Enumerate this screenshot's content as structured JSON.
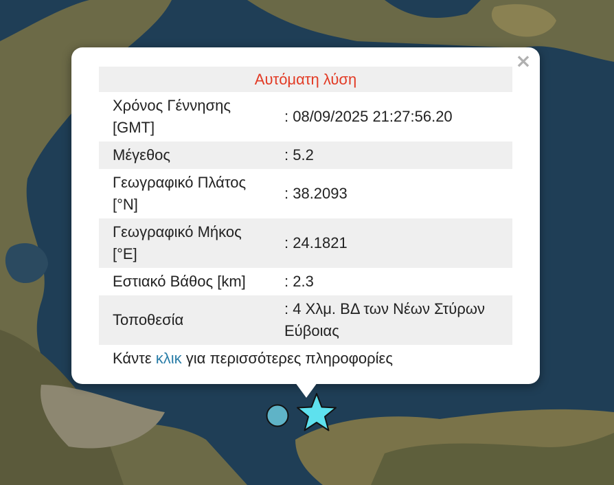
{
  "popup": {
    "close_label": "×",
    "title": "Αυτόματη λύση",
    "rows": [
      {
        "label": "Χρόνος Γέννησης [GMT]",
        "value": ": 08/09/2025 21:27:56.20"
      },
      {
        "label": "Μέγεθος",
        "value": ": 5.2"
      },
      {
        "label": "Γεωγραφικό Πλάτος [°N]",
        "value": ": 38.2093"
      },
      {
        "label": "Γεωγραφικό Μήκος [°E]",
        "value": ": 24.1821"
      },
      {
        "label": "Εστιακό Βάθος [km]",
        "value": ": 2.3"
      },
      {
        "label": "Τοποθεσία",
        "value": ": 4 Χλμ. ΒΔ των Νέων Στύρων Εύβοιας"
      }
    ],
    "footer": {
      "prefix": "Κάντε ",
      "link": "κλικ",
      "suffix": " για περισσότερες πληροφορίες"
    }
  },
  "markers": {
    "circle_icon": "circle-marker",
    "star_icon": "star-marker",
    "circle_color": "#5fb3c7",
    "star_color": "#5ee1ee"
  },
  "colors": {
    "title_color": "#e23a24",
    "link_color": "#2b7ea8",
    "sea": "#1e3d55",
    "land": "#6b6a45"
  }
}
